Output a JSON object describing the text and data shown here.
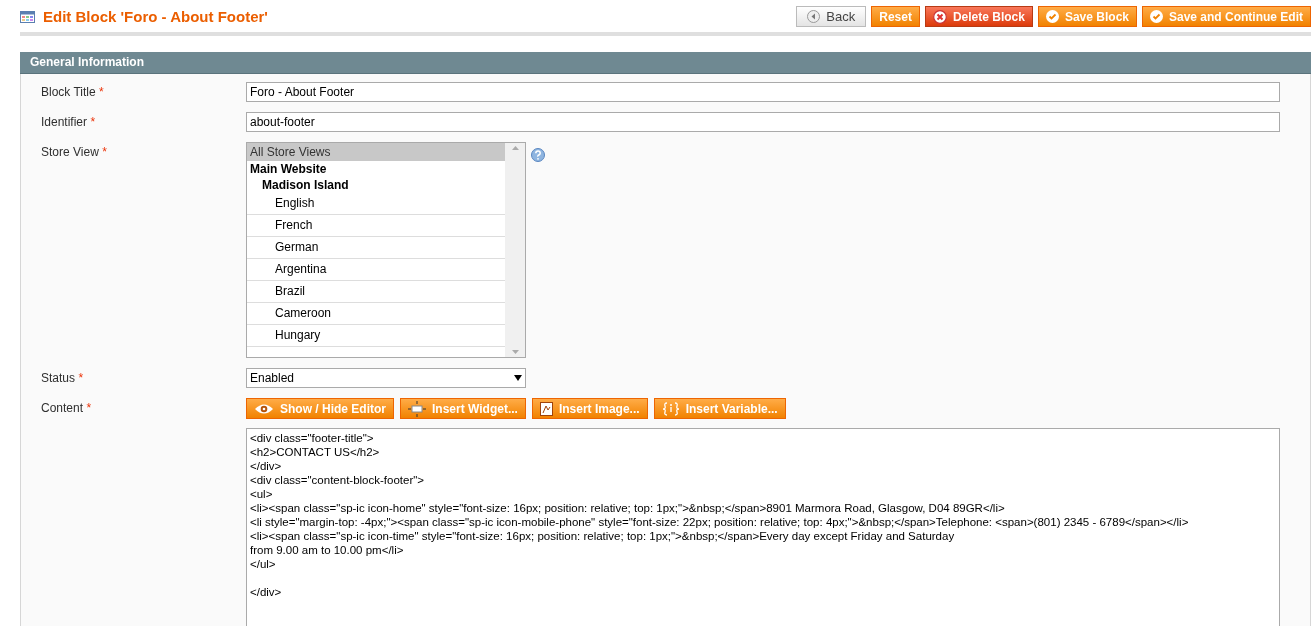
{
  "header": {
    "title": "Edit Block 'Foro - About Footer'"
  },
  "actions": [
    {
      "label": "Back",
      "kind": "back"
    },
    {
      "label": "Reset",
      "kind": "plain"
    },
    {
      "label": "Delete Block",
      "kind": "delete"
    },
    {
      "label": "Save Block",
      "kind": "save"
    },
    {
      "label": "Save and Continue Edit",
      "kind": "save"
    }
  ],
  "section": {
    "title": "General Information"
  },
  "fields": [
    {
      "label": "Block Title",
      "required_mark": "*",
      "kind": "text",
      "value": "Foro - About Footer"
    },
    {
      "label": "Identifier",
      "required_mark": "*",
      "kind": "text",
      "value": "about-footer"
    },
    {
      "label": "Store View",
      "required_mark": "*",
      "kind": "multiselect",
      "help": true,
      "options": [
        {
          "label": "All Store Views",
          "selected": true
        },
        {
          "label": "Main Website",
          "children": [
            {
              "label": "Madison Island",
              "children": [
                {
                  "label": "English",
                  "selected": false
                },
                {
                  "label": "French",
                  "selected": false
                },
                {
                  "label": "German",
                  "selected": false
                },
                {
                  "label": "Argentina",
                  "selected": false
                },
                {
                  "label": "Brazil",
                  "selected": false
                },
                {
                  "label": "Cameroon",
                  "selected": false
                },
                {
                  "label": "Hungary",
                  "selected": false
                }
              ]
            }
          ]
        }
      ]
    },
    {
      "label": "Status",
      "required_mark": "*",
      "kind": "select",
      "value": "Enabled"
    },
    {
      "label": "Content",
      "required_mark": "*",
      "kind": "editor",
      "buttons": [
        {
          "label": "Show / Hide Editor",
          "kind": "eye"
        },
        {
          "label": "Insert Widget...",
          "kind": "widget"
        },
        {
          "label": "Insert Image...",
          "kind": "image"
        },
        {
          "label": "Insert Variable...",
          "kind": "variable"
        }
      ],
      "value": "<div class=\"footer-title\">\n<h2>CONTACT US</h2>\n</div>\n<div class=\"content-block-footer\">\n<ul>\n<li><span class=\"sp-ic icon-home\" style=\"font-size: 16px; position: relative; top: 1px;\">&nbsp;</span>8901 Marmora Road, Glasgow, D04 89GR</li>\n<li style=\"margin-top: -4px;\"><span class=\"sp-ic icon-mobile-phone\" style=\"font-size: 22px; position: relative; top: 4px;\">&nbsp;</span>Telephone: <span>(801) 2345 - 6789</span></li>\n<li><span class=\"sp-ic icon-time\" style=\"font-size: 16px; position: relative; top: 1px;\">&nbsp;</span>Every day except Friday and Saturday\nfrom 9.00 am to 10.00 pm</li>\n</ul>\n\n</div>"
    }
  ]
}
